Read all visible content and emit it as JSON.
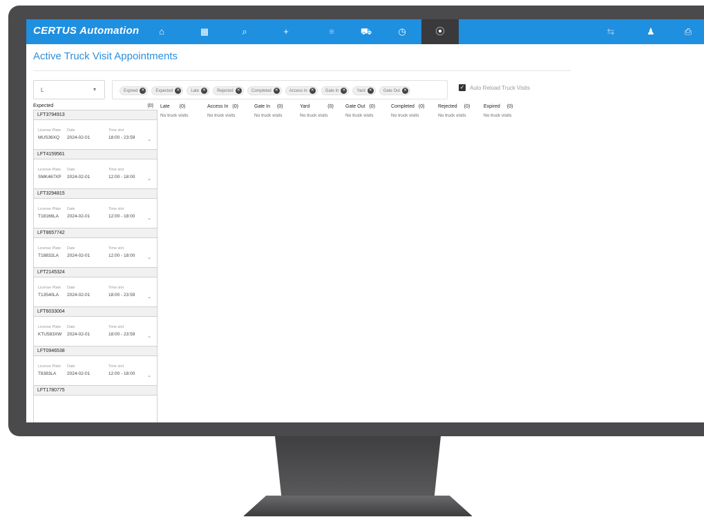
{
  "app": {
    "brand": "CERTUS Automation",
    "page_title": "Active Truck Visit Appointments"
  },
  "nav": [
    {
      "icon": "home-icon",
      "glyph": "⌂"
    },
    {
      "icon": "calendar-icon",
      "glyph": "▦"
    },
    {
      "icon": "search-icon",
      "glyph": "⌕"
    },
    {
      "icon": "add-icon",
      "glyph": "+"
    },
    {
      "icon": "list-icon",
      "glyph": "≡"
    },
    {
      "icon": "truck-icon",
      "glyph": "⛟"
    },
    {
      "icon": "clock-icon",
      "glyph": "◷"
    },
    {
      "icon": "traffic-light-icon",
      "glyph": "⦿"
    }
  ],
  "nav_right": [
    {
      "icon": "swap-icon",
      "glyph": "⇆"
    },
    {
      "icon": "user-icon",
      "glyph": "♟"
    },
    {
      "icon": "printer-icon",
      "glyph": "⎙"
    }
  ],
  "filters": {
    "type_value": "L",
    "chips": [
      "Expired",
      "Expected",
      "Late",
      "Rejected",
      "Completed",
      "Access In",
      "Gate In",
      "Yard",
      "Gate Out"
    ],
    "auto_reload_label": "Auto Reload Truck Visits",
    "auto_reload_checked": true
  },
  "columns": [
    {
      "name": "Late",
      "count": "(0)",
      "empty": "No truck visits"
    },
    {
      "name": "Access In",
      "count": "(0)",
      "empty": "No truck visits"
    },
    {
      "name": "Gate In",
      "count": "(0)",
      "empty": "No truck visits"
    },
    {
      "name": "Yard",
      "count": "(0)",
      "empty": "No truck visits"
    },
    {
      "name": "Gate Out",
      "count": "(0)",
      "empty": "No truck visits"
    },
    {
      "name": "Completed",
      "count": "(0)",
      "empty": "No truck visits"
    },
    {
      "name": "Rejected",
      "count": "(0)",
      "empty": "No truck visits"
    },
    {
      "name": "Expired",
      "count": "(0)",
      "empty": "No truck visits"
    }
  ],
  "expected": {
    "name": "Expected",
    "count": "(0)",
    "labels": {
      "plate": "License Plate",
      "date": "Date",
      "slot": "Time slot"
    },
    "cards": [
      {
        "id": "LFT3794913",
        "plate": "MUS36XQ",
        "date": "2024-02-01",
        "slot": "18:00 - 23:59"
      },
      {
        "id": "LFT4159561",
        "plate": "SMK467XP",
        "date": "2024-02-01",
        "slot": "12:00 - 18:00"
      },
      {
        "id": "LFT3294815",
        "plate": "T18166LA",
        "date": "2024-02-01",
        "slot": "12:00 - 18:00"
      },
      {
        "id": "LFT8657742",
        "plate": "T18832LA",
        "date": "2024-02-01",
        "slot": "12:00 - 18:00"
      },
      {
        "id": "LFT2145324",
        "plate": "T13540LA",
        "date": "2024-02-01",
        "slot": "18:00 - 23:59"
      },
      {
        "id": "LFT6033004",
        "plate": "KTU583XW",
        "date": "2024-02-01",
        "slot": "18:00 - 23:59"
      },
      {
        "id": "LFT0946538",
        "plate": "T8383LA",
        "date": "2024-02-01",
        "slot": "12:00 - 18:00"
      },
      {
        "id": "LFT1780775"
      }
    ]
  },
  "colors": {
    "navbar": "#1f8fe0",
    "title": "#2d8fdc",
    "active_nav": "#3a3a3c",
    "bezel": "#4a4a4c"
  }
}
